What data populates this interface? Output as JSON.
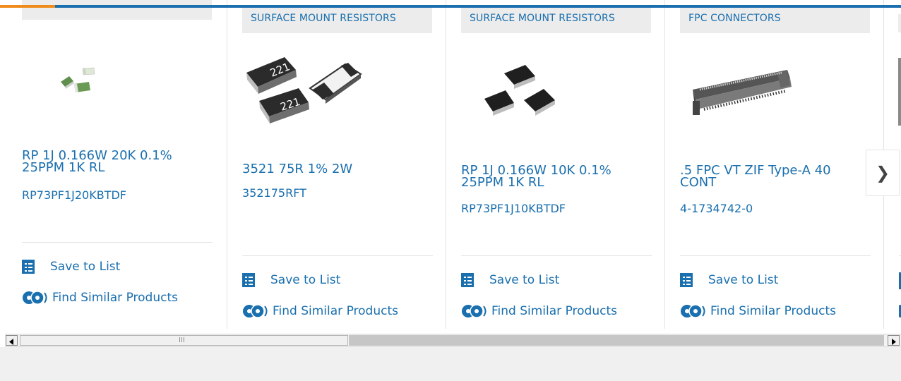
{
  "colors": {
    "brand_blue": "#1a6fae",
    "accent_orange": "#f08b1d",
    "category_bg": "#ececec"
  },
  "actions": {
    "save_label": "Save to List",
    "similar_label": "Find Similar Products"
  },
  "products": [
    {
      "category": "",
      "title_line1": "RP 1J 0.166W 20K 0.1%",
      "title_line2": "25PPM 1K RL",
      "part_number": "RP73PF1J20KBTDF"
    },
    {
      "category": "SURFACE MOUNT RESISTORS",
      "title_line1": "3521 75R 1% 2W",
      "title_line2": "",
      "part_number": "352175RFT",
      "chip_label": "221"
    },
    {
      "category": "SURFACE MOUNT RESISTORS",
      "title_line1": "RP 1J 0.166W 10K 0.1%",
      "title_line2": "25PPM 1K RL",
      "part_number": "RP73PF1J10KBTDF"
    },
    {
      "category": "FPC CONNECTORS",
      "title_line1": ".5 FPC VT ZIF Type-A 40",
      "title_line2": "CONT",
      "part_number": "4-1734742-0"
    }
  ],
  "next_button_icon": "chevron-right-icon",
  "scrollbar": {
    "thumb_grip": "III",
    "left_arrow_icon": "scroll-left-icon",
    "right_arrow_icon": "scroll-right-icon"
  }
}
